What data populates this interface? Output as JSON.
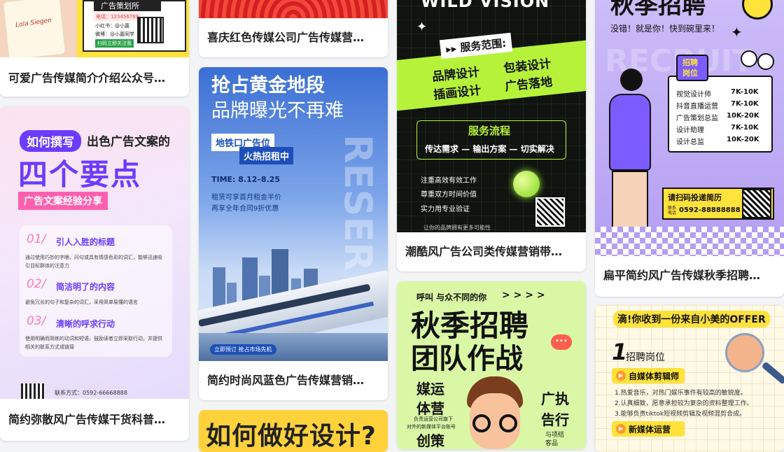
{
  "cards": {
    "c1": {
      "title": "可爱广告传媒简介介绍公众号…",
      "lines": [
        "广告策划所",
        "电话：123456789",
        "小红书：@小嘉",
        "微博：@小嘉同学",
        "扫码立即关注我"
      ]
    },
    "c2": {
      "title": "简约弥散风广告传媒干货科普…",
      "tag": "如何撰写",
      "head": "出色广告文案的",
      "big": "四个要点",
      "sub": "广告文案经验分享",
      "items": [
        {
          "num": "01/",
          "head": "引人入胜的标题",
          "desc": "通过使用巧妙的字眼、问句或具有情感色彩的词汇，能够迅速吸引目标群体的注意力"
        },
        {
          "num": "02/",
          "head": "简洁明了的内容",
          "desc": "避免冗长的句子和复杂的词汇，采用简单易懂的语言"
        },
        {
          "num": "03/",
          "head": "清晰的呼求行动",
          "desc": "使用明确而简练的动词和短语，鼓励读者立即采取行动，并提供相关的联系方式或链接"
        }
      ],
      "contact": "联系方式：0592-66668888"
    },
    "c3": {
      "title": "喜庆红色传媒公司广告传媒营…"
    },
    "c4": {
      "title": "简约时尚风蓝色广告传媒营销…",
      "h1": "抢占黄金地段",
      "h2": "品牌曝光不再难",
      "b1": "地铁口广告位",
      "b2": "火热招租中",
      "time": "TIME: 8.12–8.25",
      "p1": "租赁可享首月租金半价",
      "p2": "再享全年合同9折优惠",
      "cta": "立即预订 抢占市场先机",
      "vert": "RESER"
    },
    "c5": {
      "text": "如何做好设计?"
    },
    "c6": {
      "title": "潮酷风广告公司类传媒营销带…",
      "wild": "WILD VISION",
      "range": "▸▸ 服务范围:",
      "s1": "品牌设计",
      "s2": "包装设计",
      "s3": "插画设计",
      "s4": "广告落地",
      "flow": "服务流程",
      "flowline": "传达需求 — 输出方案 — 切实解决",
      "b1": "注重高效有效工作",
      "b2": "尊重双方时间价值",
      "b3": "实力用专业验证",
      "foot": "让你的品牌拥有更多可能性"
    },
    "c7": {
      "hi": "呼叫 与众不同的你",
      "arrows": "> > > >",
      "big1": "秋季招聘",
      "big2": "团队作战",
      "r1": "媒运",
      "r2": "体营",
      "r3": "创策",
      "rr1": "广执",
      "rr2": "告行",
      "note1": "负责运营公司旗下",
      "note2": "对外的新媒体平台账号",
      "rn1": "与项结",
      "rn2": "客品"
    },
    "c8": {
      "title": "扁平简约风广告传媒秋季招聘…",
      "big": "秋季招聘",
      "tag": "没错！就是你！快到碗里来！",
      "badge1": "招聘",
      "badge2": "岗位",
      "jobs": [
        {
          "name": "视觉设计师",
          "pay": "7K-10K"
        },
        {
          "name": "抖音直播运营",
          "pay": "7K-10K"
        },
        {
          "name": "广告策划总监",
          "pay": "10K-20K"
        },
        {
          "name": "设计助理",
          "pay": "7K-10K"
        },
        {
          "name": "设计总监",
          "pay": "10K-20K"
        }
      ],
      "scan": "请扫码投递简历",
      "tel_label": "联系电话",
      "tel": "0592-88888888",
      "wm": "RECRUIT"
    },
    "c9": {
      "offer": "滴!你收到一份来自小美的OFFER",
      "num": "1",
      "sect": "招聘岗位",
      "j1": "自媒体剪辑师",
      "d1": "1.热爱音乐，对热门娱乐事件有较高的敏锐度。",
      "d2": "2.认真细致，愿意承担较为复杂的资料整理工作。",
      "d3": "3.能够负责tiktok短视频剪辑及视频混剪合成。",
      "j2": "新媒体运营"
    }
  },
  "colors": {
    "bg": "#f3f4f6",
    "card": "#ffffff",
    "title": "#222222"
  }
}
